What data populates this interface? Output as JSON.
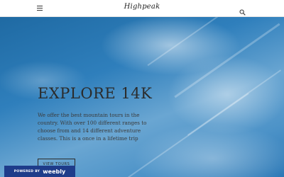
{
  "header": {
    "logo_text": "Highpeak",
    "menu_icon": "hamburger-menu-icon",
    "search_icon": "search-icon"
  },
  "hero": {
    "title": "EXPLORE 14K",
    "description": "We offer the best mountain tours in the country. With over 100 different ranges to choose from and 14 different adventure classes. This is a once in a lifetime trip",
    "button_label": "VIEW TOURS"
  },
  "footer_badge": {
    "prefix": "POWERED BY",
    "brand": "weebly",
    "color": "#1e3c8a"
  }
}
